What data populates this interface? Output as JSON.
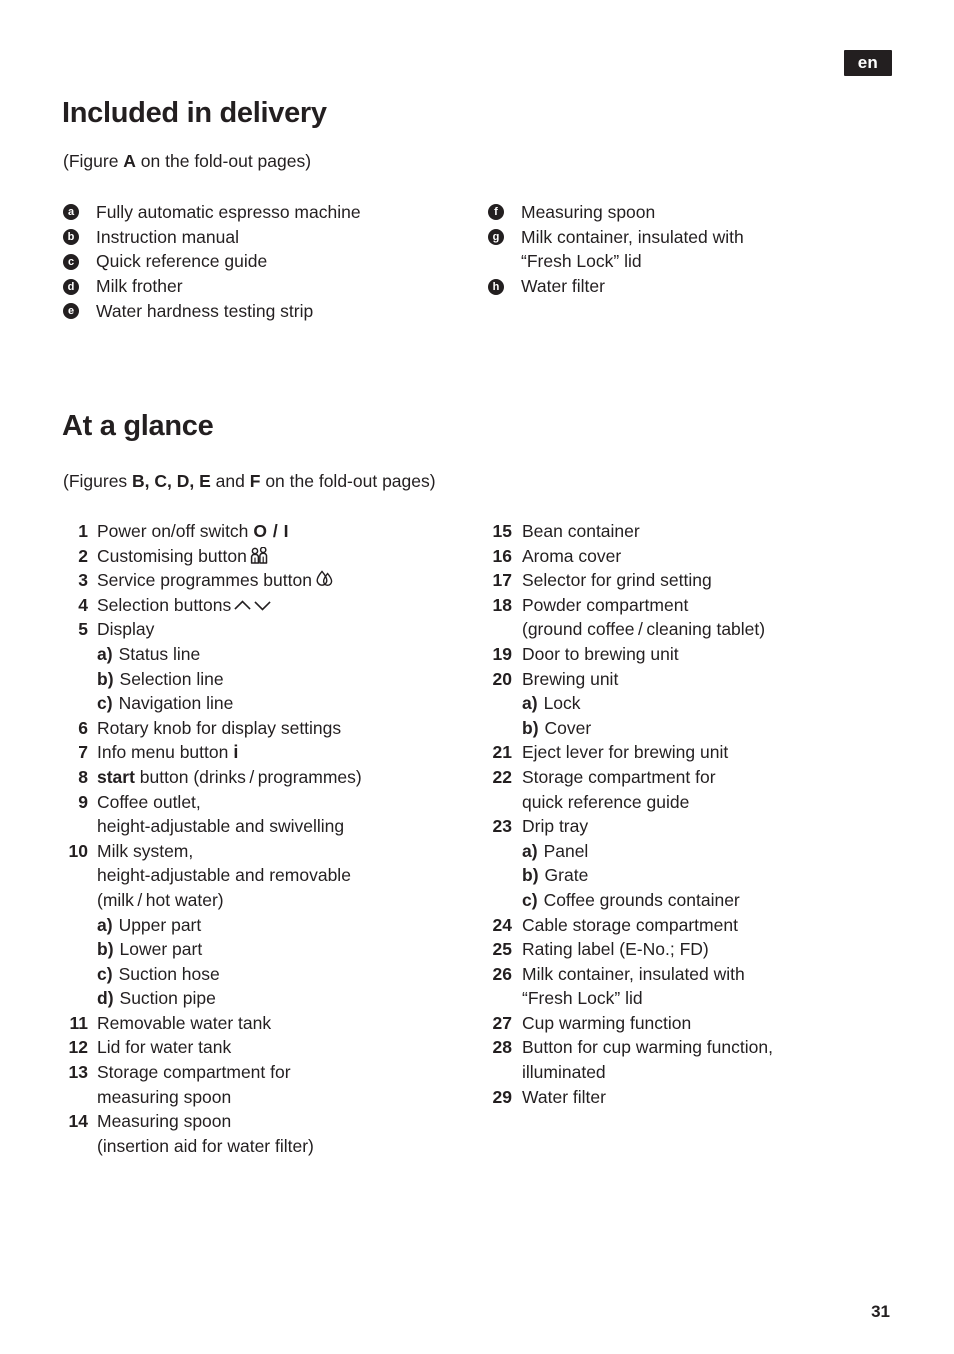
{
  "header": {
    "language_badge": "en",
    "badge_bg": "#231f20",
    "badge_fg": "#ffffff"
  },
  "page_number": "31",
  "sections": {
    "delivery": {
      "title": "Included in delivery",
      "figure_note_prefix": "(Figure ",
      "figure_note_bold": "A",
      "figure_note_suffix": " on the fold-out pages)",
      "items_left": [
        {
          "letter": "a",
          "text": "Fully automatic espresso machine"
        },
        {
          "letter": "b",
          "text": "Instruction manual"
        },
        {
          "letter": "c",
          "text": "Quick reference guide"
        },
        {
          "letter": "d",
          "text": "Milk frother"
        },
        {
          "letter": "e",
          "text": "Water hardness testing strip"
        }
      ],
      "items_right": [
        {
          "letter": "f",
          "text": "Measuring spoon"
        },
        {
          "letter": "g",
          "text": "Milk container, insulated with",
          "cont": "“Fresh Lock” lid"
        },
        {
          "letter": "h",
          "text": "Water filter"
        }
      ]
    },
    "glance": {
      "title": "At a glance",
      "figure_note_prefix": "(Figures ",
      "figure_note_bold": "B, C, D, E",
      "figure_note_mid": " and ",
      "figure_note_bold2": "F",
      "figure_note_suffix": " on the fold-out pages)",
      "items_left": [
        {
          "num": "1",
          "text": "Power on/off switch",
          "icon": "power-on-off-symbol",
          "icon_text": "O / I"
        },
        {
          "num": "2",
          "text": "Customising button",
          "icon": "customising-people-icon"
        },
        {
          "num": "3",
          "text": "Service programmes button",
          "icon": "service-programmes-droplets-icon"
        },
        {
          "num": "4",
          "text": "Selection buttons",
          "icon": "chevron-up-down-icon"
        },
        {
          "num": "5",
          "text": "Display",
          "subs": [
            {
              "label": "a)",
              "text": "Status line"
            },
            {
              "label": "b)",
              "text": "Selection line"
            },
            {
              "label": "c)",
              "text": "Navigation line"
            }
          ]
        },
        {
          "num": "6",
          "text": "Rotary knob for display settings"
        },
        {
          "num": "7",
          "text": "Info menu button",
          "icon": "info-menu-icon",
          "icon_text": "i"
        },
        {
          "num": "8",
          "bold_lead": "start",
          "text": " button (drinks / programmes)"
        },
        {
          "num": "9",
          "text": "Coffee outlet,",
          "cont": [
            "height-adjustable and swivelling"
          ]
        },
        {
          "num": "10",
          "text": "Milk system,",
          "cont": [
            "height-adjustable and removable",
            "(milk / hot water)"
          ],
          "subs": [
            {
              "label": "a)",
              "text": "Upper part"
            },
            {
              "label": "b)",
              "text": "Lower part"
            },
            {
              "label": "c)",
              "text": "Suction hose"
            },
            {
              "label": "d)",
              "text": "Suction pipe"
            }
          ]
        },
        {
          "num": "11",
          "text": "Removable water tank"
        },
        {
          "num": "12",
          "text": "Lid for water tank"
        },
        {
          "num": "13",
          "text": "Storage compartment for",
          "cont": [
            "measuring spoon"
          ]
        },
        {
          "num": "14",
          "text": "Measuring spoon",
          "cont": [
            "(insertion aid for water filter)"
          ]
        }
      ],
      "items_right": [
        {
          "num": "15",
          "text": "Bean container"
        },
        {
          "num": "16",
          "text": "Aroma cover"
        },
        {
          "num": "17",
          "text": "Selector for grind setting"
        },
        {
          "num": "18",
          "text": "Powder compartment",
          "cont": [
            "(ground coffee / cleaning tablet)"
          ]
        },
        {
          "num": "19",
          "text": "Door to brewing unit"
        },
        {
          "num": "20",
          "text": "Brewing unit",
          "subs": [
            {
              "label": "a)",
              "text": "Lock"
            },
            {
              "label": "b)",
              "text": "Cover"
            }
          ]
        },
        {
          "num": "21",
          "text": "Eject lever for brewing unit"
        },
        {
          "num": "22",
          "text": "Storage compartment for",
          "cont": [
            "quick reference guide"
          ]
        },
        {
          "num": "23",
          "text": "Drip tray",
          "subs": [
            {
              "label": "a)",
              "text": "Panel"
            },
            {
              "label": "b)",
              "text": "Grate"
            },
            {
              "label": "c)",
              "text": "Coffee grounds container"
            }
          ]
        },
        {
          "num": "24",
          "text": "Cable storage compartment"
        },
        {
          "num": "25",
          "text": "Rating label (E-No.; FD)"
        },
        {
          "num": "26",
          "text": "Milk container, insulated with",
          "cont": [
            "“Fresh Lock” lid"
          ]
        },
        {
          "num": "27",
          "text": "Cup warming function"
        },
        {
          "num": "28",
          "text": "Button for cup warming function,",
          "cont": [
            "illuminated"
          ]
        },
        {
          "num": "29",
          "text": "Water filter"
        }
      ]
    }
  }
}
